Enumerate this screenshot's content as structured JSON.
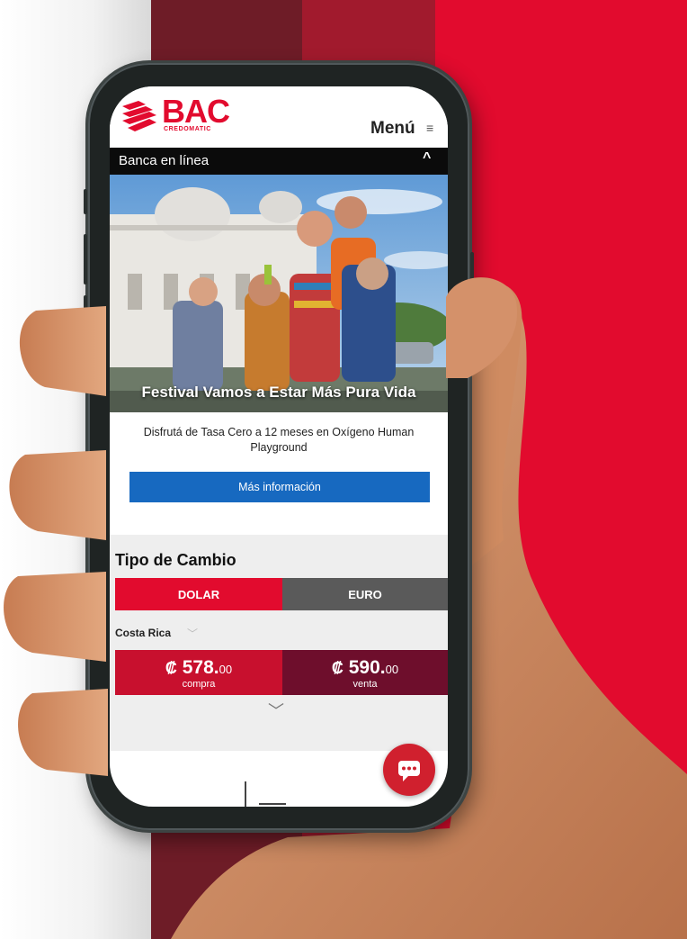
{
  "colors": {
    "brand_red": "#e20b2e",
    "button_blue": "#1769c0",
    "compra_red": "#c8102e",
    "venta_maroon": "#6e0e2c",
    "euro_gray": "#5a5a5a"
  },
  "header": {
    "logo_name": "BAC",
    "logo_sub": "CREDOMATIC",
    "menu_label": "Menú",
    "menu_icon": "menu-lines-icon"
  },
  "banca": {
    "label": "Banca en línea",
    "caret": "^"
  },
  "hero": {
    "title": "Festival Vamos a Estar Más Pura Vida"
  },
  "promo": {
    "description": "Disfrutá de Tasa Cero a 12 meses en Oxígeno Human Playground",
    "button_label": "Más información"
  },
  "exchange": {
    "title": "Tipo de Cambio",
    "tabs": [
      {
        "label": "DOLAR",
        "active": true
      },
      {
        "label": "EURO",
        "active": false
      }
    ],
    "country": "Costa Rica",
    "currency_symbol": "₡",
    "compra": {
      "whole": "578.",
      "decimals": "00",
      "label": "compra"
    },
    "venta": {
      "whole": "590.",
      "decimals": "00",
      "label": "venta"
    },
    "more_icon": "chevron-down-icon"
  },
  "chat": {
    "icon": "chat-bubble-icon"
  }
}
